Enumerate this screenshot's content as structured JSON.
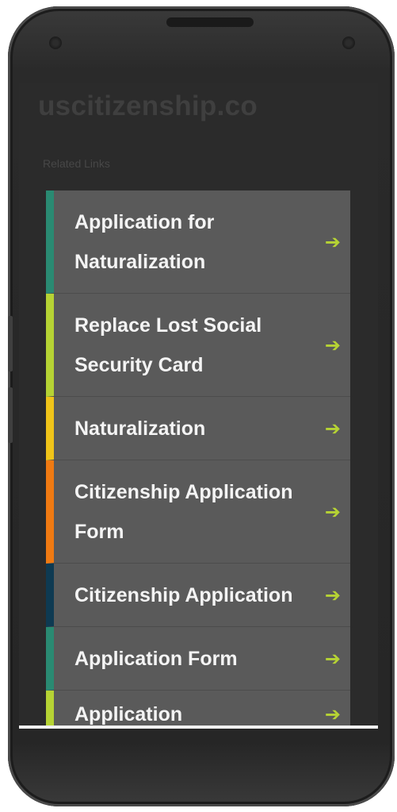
{
  "site": {
    "title": "uscitizenship.co"
  },
  "related": {
    "label": "Related Links",
    "arrow_glyph": "➔",
    "arrow_color": "#b6d334",
    "items": [
      {
        "label": "Application for Naturalization",
        "accent": "#2a8a72"
      },
      {
        "label": "Replace Lost Social Security Card",
        "accent": "#b6d334"
      },
      {
        "label": "Naturalization",
        "accent": "#f0c419"
      },
      {
        "label": "Citizenship Application Form",
        "accent": "#f07a12"
      },
      {
        "label": "Citizenship Application",
        "accent": "#0e3a52"
      },
      {
        "label": "Application Form",
        "accent": "#2a8a72"
      },
      {
        "label": "Application",
        "accent": "#b6d334"
      }
    ]
  }
}
